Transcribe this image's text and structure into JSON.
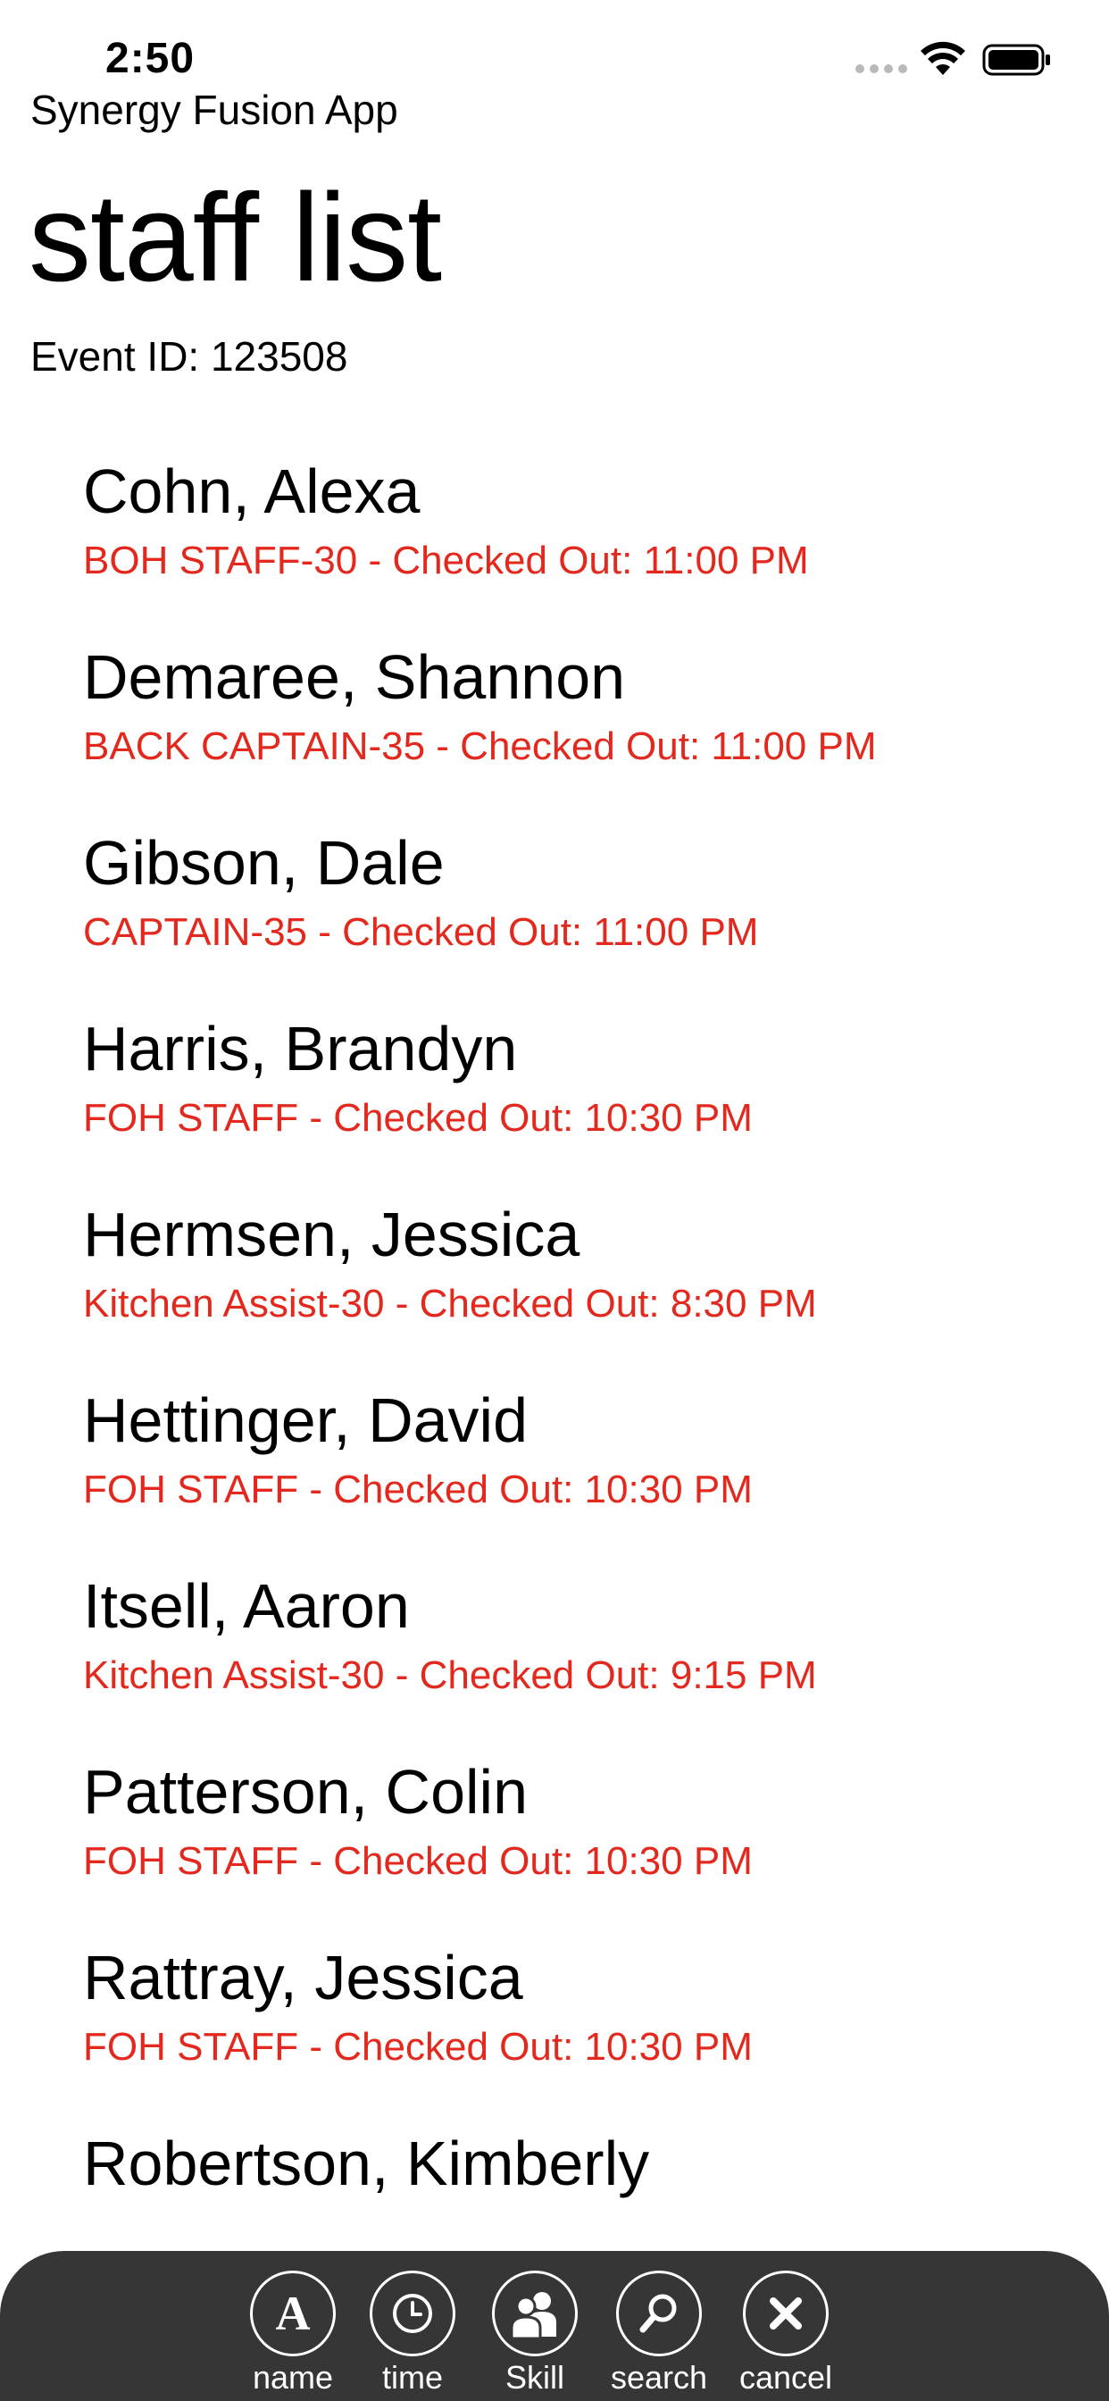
{
  "status_bar": {
    "time": "2:50"
  },
  "app": {
    "name": "Synergy Fusion App"
  },
  "page": {
    "title": "staff list",
    "event_line": "Event ID: 123508"
  },
  "colors": {
    "detail_text": "#e3281e",
    "toolbar_bg": "#363636"
  },
  "staff": [
    {
      "name": "Cohn, Alexa",
      "detail": "BOH STAFF-30 - Checked Out: 11:00 PM"
    },
    {
      "name": "Demaree, Shannon",
      "detail": "BACK CAPTAIN-35 - Checked Out: 11:00 PM"
    },
    {
      "name": "Gibson, Dale",
      "detail": "CAPTAIN-35 - Checked Out: 11:00 PM"
    },
    {
      "name": "Harris, Brandyn",
      "detail": "FOH STAFF - Checked Out: 10:30 PM"
    },
    {
      "name": "Hermsen, Jessica",
      "detail": "Kitchen Assist-30 - Checked Out: 8:30 PM"
    },
    {
      "name": "Hettinger, David",
      "detail": "FOH STAFF - Checked Out: 10:30 PM"
    },
    {
      "name": "Itsell, Aaron",
      "detail": "Kitchen Assist-30 - Checked Out: 9:15 PM"
    },
    {
      "name": "Patterson, Colin",
      "detail": "FOH STAFF - Checked Out: 10:30 PM"
    },
    {
      "name": "Rattray, Jessica",
      "detail": "FOH STAFF - Checked Out: 10:30 PM"
    },
    {
      "name": "Robertson, Kimberly",
      "detail": ""
    }
  ],
  "toolbar": {
    "items": [
      {
        "label": "name",
        "icon": "letter-a-icon"
      },
      {
        "label": "time",
        "icon": "clock-icon"
      },
      {
        "label": "Skill",
        "icon": "people-icon"
      },
      {
        "label": "search",
        "icon": "search-icon"
      },
      {
        "label": "cancel",
        "icon": "close-icon"
      }
    ]
  }
}
